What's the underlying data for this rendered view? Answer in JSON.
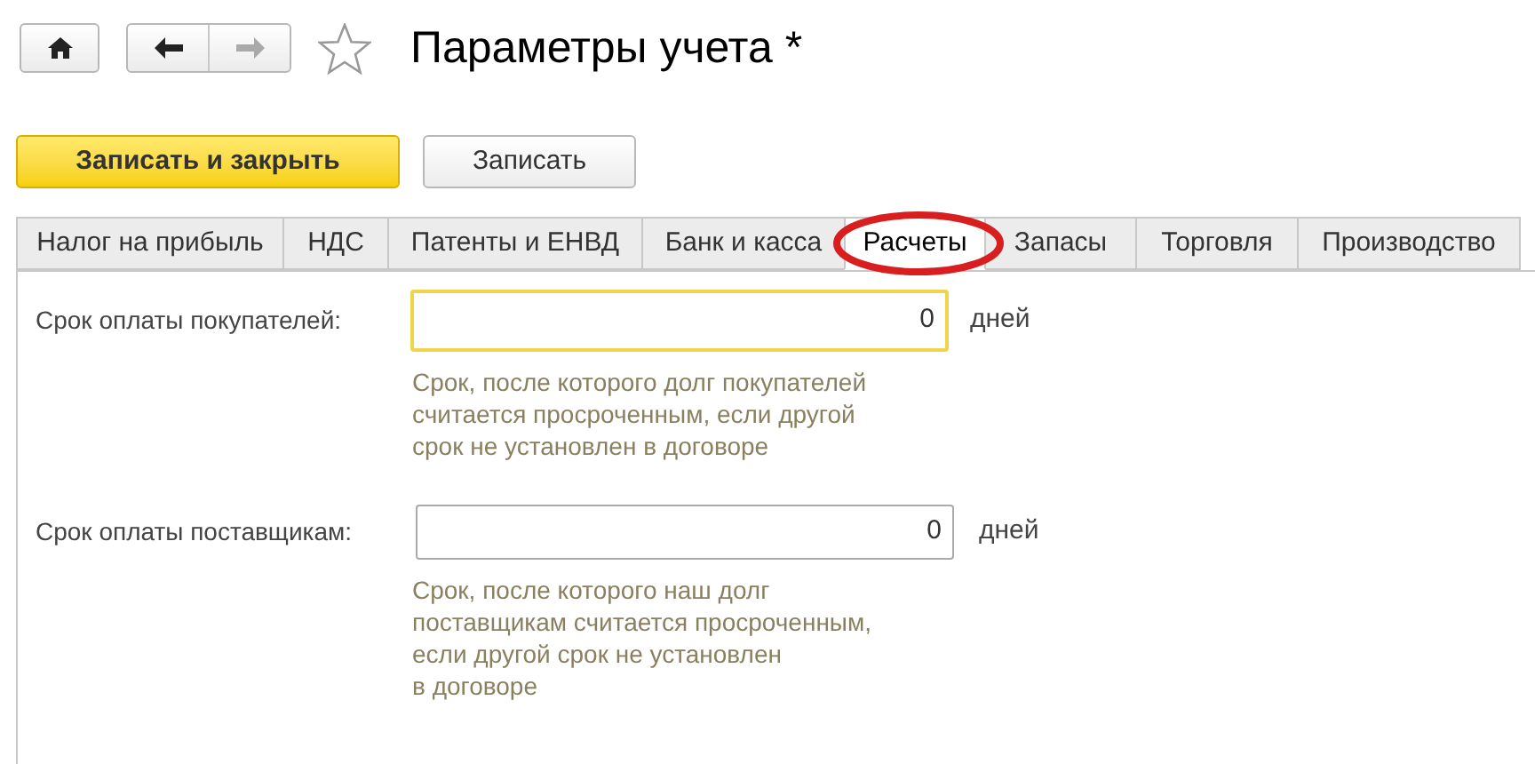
{
  "window": {
    "title": "Параметры учета *",
    "favorite": false
  },
  "actions": [
    {
      "label": "Записать и закрыть",
      "kind": "primary"
    },
    {
      "label": "Записать",
      "kind": "secondary"
    }
  ],
  "tabs": [
    {
      "label": "Налог на прибыль",
      "selected": false
    },
    {
      "label": "НДС",
      "selected": false
    },
    {
      "label": "Патенты и ЕНВД",
      "selected": false
    },
    {
      "label": "Банк и касса",
      "selected": false
    },
    {
      "label": "Расчеты",
      "selected": true,
      "circled": true
    },
    {
      "label": "Запасы",
      "selected": false
    },
    {
      "label": "Торговля",
      "selected": false
    },
    {
      "label": "Производство",
      "selected": false
    }
  ],
  "fields": [
    {
      "label": "Срок оплаты покупателей:",
      "value": "0",
      "unit": "дней",
      "focused": true,
      "hint_lines": [
        "Срок, после которого долг покупателей",
        "считается просроченным, если другой",
        "срок не установлен в договоре"
      ]
    },
    {
      "label": "Срок оплаты поставщикам:",
      "value": "0",
      "unit": "дней",
      "focused": false,
      "hint_lines": [
        "Срок, после которого наш долг",
        "поставщикам считается просроченным,",
        "если другой срок не установлен",
        "в договоре"
      ]
    }
  ]
}
